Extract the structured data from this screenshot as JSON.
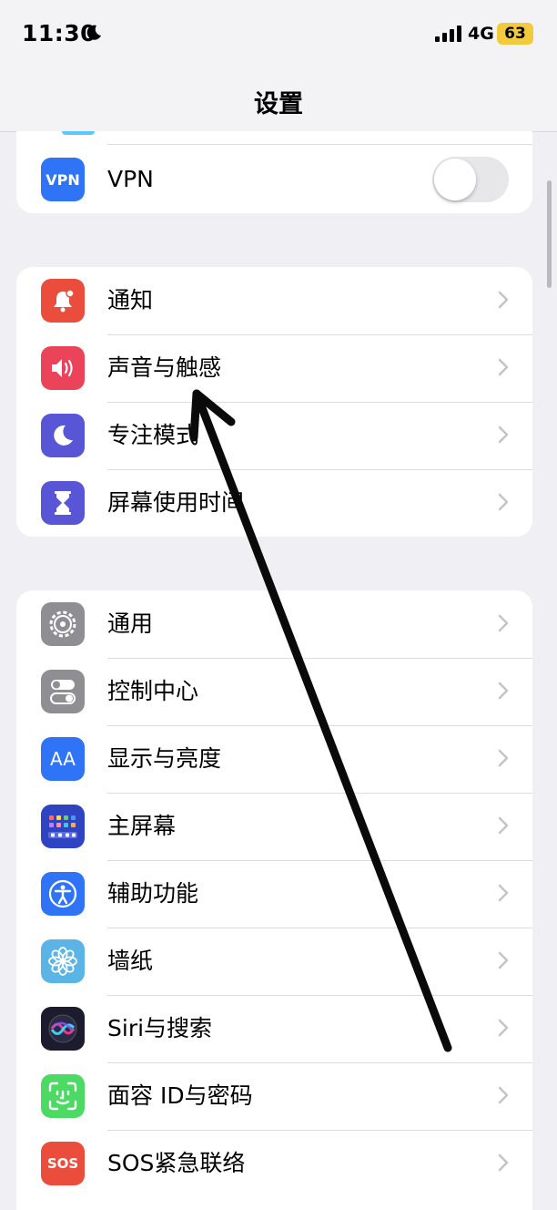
{
  "status_bar": {
    "time": "11:30",
    "network": "4G",
    "battery": "63",
    "battery_color": "#f2cb3c"
  },
  "header": {
    "title": "设置"
  },
  "vpn_row": {
    "icon_text": "VPN",
    "label": "VPN",
    "toggle_on": false,
    "icon_color": "#2f74f6"
  },
  "group_focus": {
    "items": [
      {
        "label": "通知",
        "icon": "bell-badge-icon",
        "color": "#eb4d3d"
      },
      {
        "label": "声音与触感",
        "icon": "speaker-icon",
        "color": "#eb445a"
      },
      {
        "label": "专注模式",
        "icon": "moon-icon",
        "color": "#5856d6"
      },
      {
        "label": "屏幕使用时间",
        "icon": "hourglass-icon",
        "color": "#5856d6"
      }
    ]
  },
  "group_general": {
    "items": [
      {
        "label": "通用",
        "icon": "gear-icon",
        "color": "#8e8e93"
      },
      {
        "label": "控制中心",
        "icon": "switches-icon",
        "color": "#8e8e93"
      },
      {
        "label": "显示与亮度",
        "icon": "text-size-icon",
        "color": "#2f74f6",
        "icon_text": "AA"
      },
      {
        "label": "主屏幕",
        "icon": "home-grid-icon",
        "color": "#2e44c2"
      },
      {
        "label": "辅助功能",
        "icon": "accessibility-icon",
        "color": "#2f74f6"
      },
      {
        "label": "墙纸",
        "icon": "flower-icon",
        "color": "#5ab4e6"
      },
      {
        "label": "Siri与搜索",
        "icon": "siri-icon",
        "color": "#1c1c2e"
      },
      {
        "label": "面容 ID与密码",
        "icon": "face-id-icon",
        "color": "#4cd964"
      },
      {
        "label": "SOS紧急联络",
        "icon": "sos-icon",
        "color": "#eb4d3d",
        "icon_text": "SOS"
      }
    ]
  }
}
